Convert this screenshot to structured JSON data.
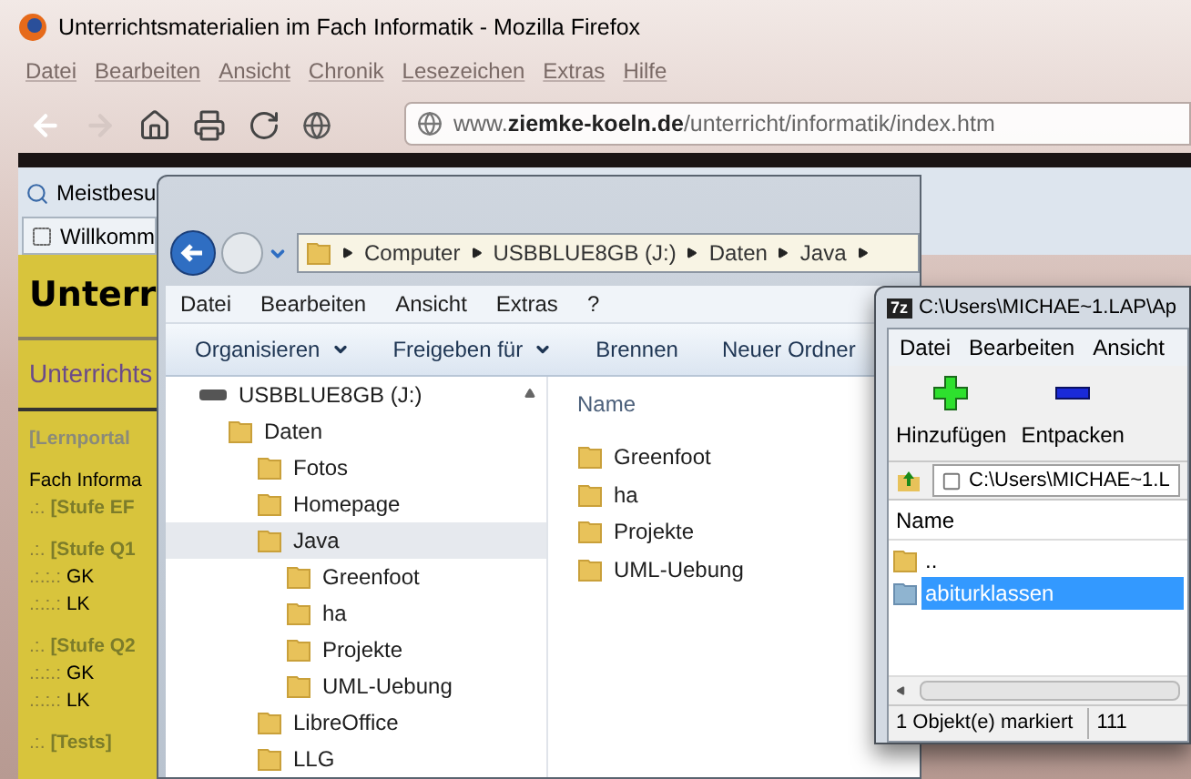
{
  "browser": {
    "title": "Unterrichtsmaterialien im Fach Informatik - Mozilla Firefox",
    "menu": [
      "Datei",
      "Bearbeiten",
      "Ansicht",
      "Chronik",
      "Lesezeichen",
      "Extras",
      "Hilfe"
    ],
    "url": {
      "prefix": "www.",
      "domain": "ziemke-koeln.de",
      "path": "/unterricht/informatik/index.htm"
    },
    "bookmark": "Meistbesu",
    "tab": "Willkomm"
  },
  "page": {
    "heading": "Unterr",
    "subtitle": "Unterrichts",
    "groups": [
      [
        {
          "kind": "portal",
          "text": "[Lernportal"
        }
      ],
      [
        {
          "kind": "plain",
          "text": "Fach Informa"
        },
        {
          "kind": "stage",
          "prefix": ".:.",
          "text": "[Stufe EF"
        }
      ],
      [
        {
          "kind": "stage",
          "prefix": ".:.",
          "text": "[Stufe Q1"
        },
        {
          "kind": "course",
          "prefix": ".:.:.:",
          "text": "GK"
        },
        {
          "kind": "course",
          "prefix": ".:.:.:",
          "text": "LK"
        }
      ],
      [
        {
          "kind": "stage",
          "prefix": ".:.",
          "text": "[Stufe Q2"
        },
        {
          "kind": "course",
          "prefix": ".:.:.:",
          "text": "GK"
        },
        {
          "kind": "course",
          "prefix": ".:.:.:",
          "text": "LK"
        }
      ],
      [
        {
          "kind": "stage",
          "prefix": ".:.",
          "text": "[Tests]"
        }
      ]
    ]
  },
  "explorer": {
    "breadcrumb": [
      "Computer",
      "USBBLUE8GB (J:)",
      "Daten",
      "Java"
    ],
    "menu": [
      "Datei",
      "Bearbeiten",
      "Ansicht",
      "Extras",
      "?"
    ],
    "toolbar": [
      {
        "label": "Organisieren",
        "dropdown": true
      },
      {
        "label": "Freigeben für",
        "dropdown": true
      },
      {
        "label": "Brennen",
        "dropdown": false
      },
      {
        "label": "Neuer Ordner",
        "dropdown": false
      }
    ],
    "tree": [
      {
        "kind": "drive",
        "name": "USBBLUE8GB (J:)",
        "selected": false,
        "children": [
          {
            "kind": "folder",
            "name": "Daten",
            "selected": false,
            "children": [
              {
                "kind": "folder",
                "name": "Fotos",
                "selected": false
              },
              {
                "kind": "folder",
                "name": "Homepage",
                "selected": false
              },
              {
                "kind": "folder",
                "name": "Java",
                "selected": true,
                "children": [
                  {
                    "kind": "folder",
                    "name": "Greenfoot",
                    "selected": false
                  },
                  {
                    "kind": "folder",
                    "name": "ha",
                    "selected": false
                  },
                  {
                    "kind": "folder",
                    "name": "Projekte",
                    "selected": false
                  },
                  {
                    "kind": "folder",
                    "name": "UML-Uebung",
                    "selected": false
                  }
                ]
              },
              {
                "kind": "folder",
                "name": "LibreOffice",
                "selected": false
              },
              {
                "kind": "folder",
                "name": "LLG",
                "selected": false
              }
            ]
          }
        ]
      }
    ],
    "column": "Name",
    "files": [
      "Greenfoot",
      "ha",
      "Projekte",
      "UML-Uebung"
    ]
  },
  "seven_zip": {
    "logo": "7z",
    "title": "C:\\Users\\MICHAE~1.LAP\\Ap",
    "menu": [
      "Datei",
      "Bearbeiten",
      "Ansicht"
    ],
    "toolbar": [
      {
        "kind": "add",
        "label": "Hinzufügen"
      },
      {
        "kind": "extract",
        "label": "Entpacken"
      }
    ],
    "path": "C:\\Users\\MICHAE~1.L",
    "column": "Name",
    "rows": [
      {
        "name": "..",
        "selected": false
      },
      {
        "name": "abiturklassen",
        "selected": true
      }
    ],
    "status": [
      "1 Objekt(e) markiert",
      "111"
    ]
  }
}
